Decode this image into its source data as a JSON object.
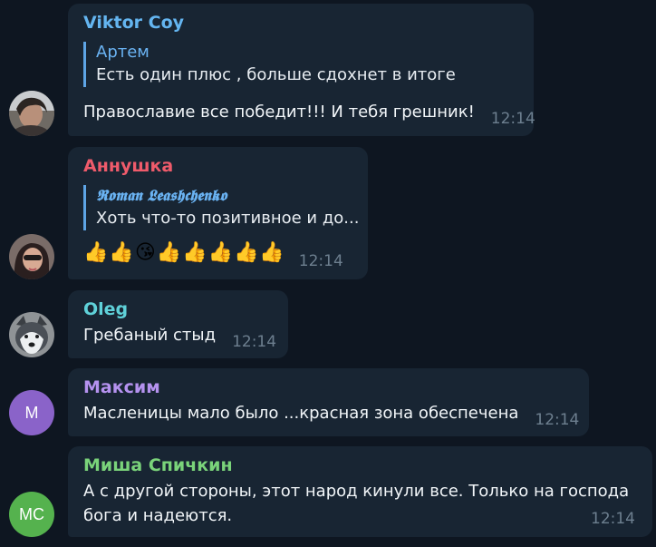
{
  "messages": [
    {
      "sender": "Viktor Coy",
      "sender_color": "#64b5f0",
      "quote_author": "Артем",
      "quote_text": "Есть один плюс , больше сдохнет в итоге",
      "text": "Православие все победит!!! И тебя грешник!",
      "time": "12:14",
      "avatar": "photo-avatar"
    },
    {
      "sender": "Аннушка",
      "sender_color": "#ef5b6b",
      "quote_author": "𝕽𝖔𝖒𝖆𝖓 𝕷𝖊𝖆𝖘𝖍𝖈𝖍𝖊𝖓𝖐𝖔",
      "quote_text": "Хоть что-то позитивное и до...",
      "emojis": [
        "👍",
        "👍",
        "😘",
        "👍",
        "👍",
        "👍",
        "👍",
        "👍"
      ],
      "time": "12:14",
      "avatar": "photo-avatar"
    },
    {
      "sender": "Oleg",
      "sender_color": "#5fd1d9",
      "text": "Гребаный стыд",
      "time": "12:14",
      "avatar": "husky-photo-avatar"
    },
    {
      "sender": "Максим",
      "sender_color": "#b592ef",
      "text": "Масленицы мало было ...красная зона обеспечена",
      "time": "12:14",
      "avatar_initials": "М",
      "avatar_color": "#8a63c9"
    },
    {
      "sender": "Миша Спичкин",
      "sender_color": "#7ad37a",
      "text_lines": [
        "А с другой стороны, этот народ кинули все. Только на господа",
        "бога и надеются."
      ],
      "time": "12:14",
      "avatar_initials": "МС",
      "avatar_color": "#55b24e"
    }
  ]
}
